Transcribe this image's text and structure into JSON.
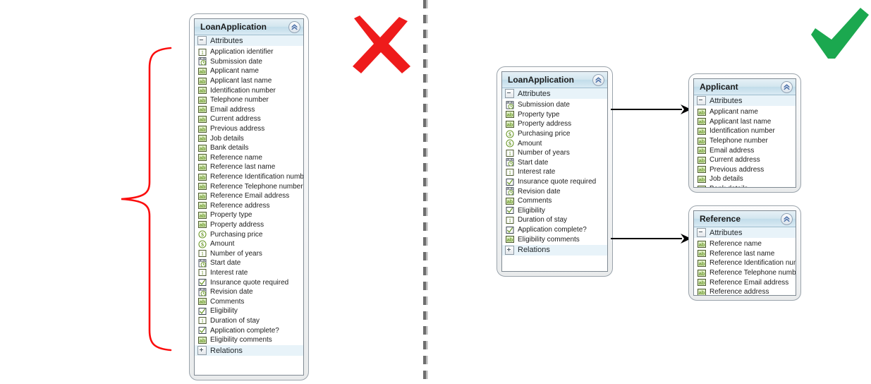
{
  "diagram": {
    "title_left": "LoanApplication",
    "divider": {
      "name": "dashed-vertical-divider"
    },
    "bad_mark": {
      "icon": "red-x-icon",
      "meaning": "incorrect"
    },
    "good_mark": {
      "icon": "green-check-icon",
      "meaning": "correct"
    },
    "brace": {
      "icon": "red-curly-brace",
      "meaning": "all attributes in one entity"
    }
  },
  "labels": {
    "attributes": "Attributes",
    "relations": "Relations",
    "collapse": "collapse"
  },
  "entities": {
    "left_loan_application": {
      "title": "LoanApplication",
      "sections": {
        "attributes": "Attributes",
        "relations": "Relations"
      },
      "attributes": [
        {
          "name": "Application identifier",
          "type": "number"
        },
        {
          "name": "Submission date",
          "type": "datetime"
        },
        {
          "name": "Applicant name",
          "type": "text"
        },
        {
          "name": "Applicant last name",
          "type": "text"
        },
        {
          "name": "Identification number",
          "type": "text"
        },
        {
          "name": "Telephone number",
          "type": "text"
        },
        {
          "name": "Email address",
          "type": "text"
        },
        {
          "name": "Current address",
          "type": "text"
        },
        {
          "name": "Previous address",
          "type": "text"
        },
        {
          "name": "Job details",
          "type": "text"
        },
        {
          "name": "Bank details",
          "type": "text"
        },
        {
          "name": "Reference name",
          "type": "text"
        },
        {
          "name": "Reference last name",
          "type": "text"
        },
        {
          "name": "Reference Identification number",
          "type": "text"
        },
        {
          "name": "Reference Telephone number",
          "type": "text"
        },
        {
          "name": "Reference Email address",
          "type": "text"
        },
        {
          "name": "Reference address",
          "type": "text"
        },
        {
          "name": "Property type",
          "type": "text"
        },
        {
          "name": "Property address",
          "type": "text"
        },
        {
          "name": "Purchasing price",
          "type": "currency"
        },
        {
          "name": "Amount",
          "type": "currency"
        },
        {
          "name": "Number of years",
          "type": "number"
        },
        {
          "name": "Start date",
          "type": "datetime"
        },
        {
          "name": "Interest rate",
          "type": "number"
        },
        {
          "name": "Insurance quote required",
          "type": "boolean"
        },
        {
          "name": "Revision date",
          "type": "datetime"
        },
        {
          "name": "Comments",
          "type": "text"
        },
        {
          "name": "Eligibility",
          "type": "boolean"
        },
        {
          "name": "Duration of stay",
          "type": "number"
        },
        {
          "name": "Application complete?",
          "type": "boolean"
        },
        {
          "name": "Eligibility comments",
          "type": "text"
        }
      ]
    },
    "right_loan_application": {
      "title": "LoanApplication",
      "sections": {
        "attributes": "Attributes",
        "relations": "Relations"
      },
      "attributes": [
        {
          "name": "Submission date",
          "type": "datetime"
        },
        {
          "name": "Property type",
          "type": "text"
        },
        {
          "name": "Property address",
          "type": "text"
        },
        {
          "name": "Purchasing price",
          "type": "currency"
        },
        {
          "name": "Amount",
          "type": "currency"
        },
        {
          "name": "Number of years",
          "type": "number"
        },
        {
          "name": "Start date",
          "type": "datetime"
        },
        {
          "name": "Interest rate",
          "type": "number"
        },
        {
          "name": "Insurance quote required",
          "type": "boolean"
        },
        {
          "name": "Revision date",
          "type": "datetime"
        },
        {
          "name": "Comments",
          "type": "text"
        },
        {
          "name": "Eligibility",
          "type": "boolean"
        },
        {
          "name": "Duration of stay",
          "type": "number"
        },
        {
          "name": "Application complete?",
          "type": "boolean"
        },
        {
          "name": "Eligibility comments",
          "type": "text"
        }
      ]
    },
    "applicant": {
      "title": "Applicant",
      "sections": {
        "attributes": "Attributes"
      },
      "attributes": [
        {
          "name": "Applicant name",
          "type": "text"
        },
        {
          "name": "Applicant last name",
          "type": "text"
        },
        {
          "name": "Identification number",
          "type": "text"
        },
        {
          "name": "Telephone number",
          "type": "text"
        },
        {
          "name": "Email address",
          "type": "text"
        },
        {
          "name": "Current address",
          "type": "text"
        },
        {
          "name": "Previous address",
          "type": "text"
        },
        {
          "name": "Job details",
          "type": "text"
        },
        {
          "name": "Bank details",
          "type": "text"
        }
      ]
    },
    "reference": {
      "title": "Reference",
      "sections": {
        "attributes": "Attributes"
      },
      "attributes": [
        {
          "name": "Reference name",
          "type": "text"
        },
        {
          "name": "Reference last name",
          "type": "text"
        },
        {
          "name": "Reference Identification number",
          "type": "text"
        },
        {
          "name": "Reference Telephone number",
          "type": "text"
        },
        {
          "name": "Reference Email address",
          "type": "text"
        },
        {
          "name": "Reference address",
          "type": "text"
        }
      ]
    }
  },
  "connections": [
    {
      "from": "right_loan_application",
      "to": "applicant",
      "name": "arrow-loanapplication-to-applicant"
    },
    {
      "from": "right_loan_application",
      "to": "reference",
      "name": "arrow-loanapplication-to-reference"
    }
  ],
  "colors": {
    "accent_header": "#c2dcea",
    "bad": "#ee1b1b",
    "good": "#1ba84f",
    "brace": "#fb0d0d",
    "icon_green": "#6f9b2f",
    "divider": "#7a7a7a"
  }
}
